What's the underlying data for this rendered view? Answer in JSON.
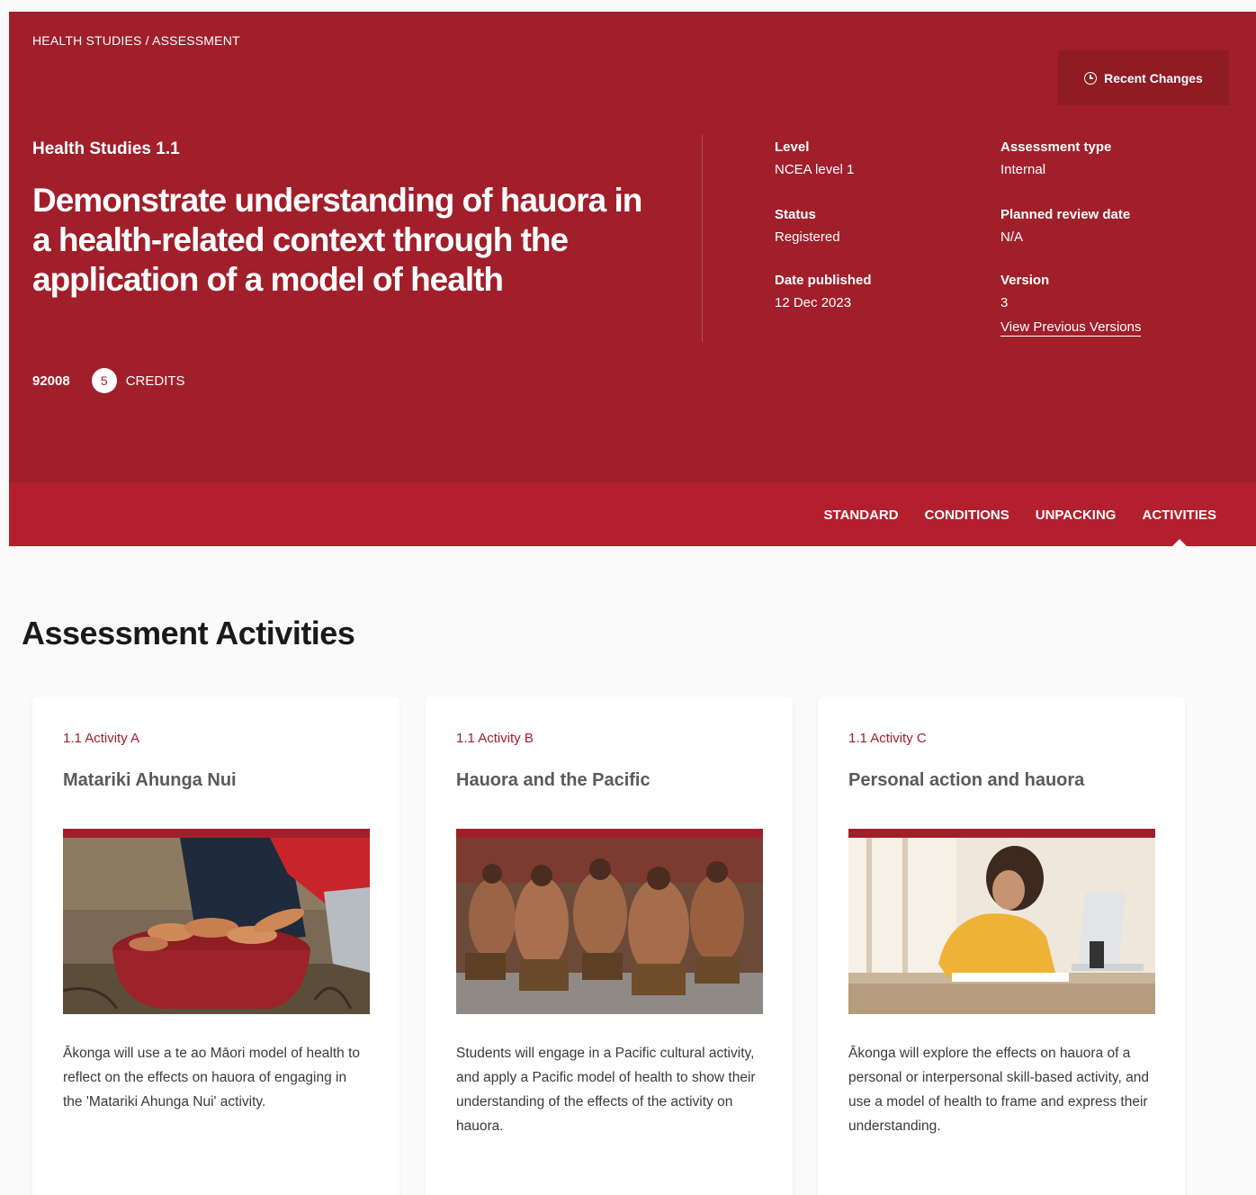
{
  "breadcrumb": {
    "subject": "HEALTH STUDIES",
    "separator": "/",
    "section": "ASSESSMENT"
  },
  "recent_changes_label": "Recent Changes",
  "standard": {
    "subject_label": "Health Studies 1.1",
    "title": "Demonstrate understanding of hauora in a health-related context through the application of a model of health",
    "code": "92008",
    "credits": "5",
    "credits_label": "CREDITS"
  },
  "meta": {
    "level": {
      "label": "Level",
      "value": "NCEA level 1"
    },
    "assessment_type": {
      "label": "Assessment type",
      "value": "Internal"
    },
    "status": {
      "label": "Status",
      "value": "Registered"
    },
    "review_date": {
      "label": "Planned review date",
      "value": "N/A"
    },
    "date_published": {
      "label": "Date published",
      "value": "12 Dec 2023"
    },
    "version": {
      "label": "Version",
      "value": "3",
      "link": "View Previous Versions"
    }
  },
  "tabs": [
    {
      "label": "STANDARD",
      "active": false
    },
    {
      "label": "CONDITIONS",
      "active": false
    },
    {
      "label": "UNPACKING",
      "active": false
    },
    {
      "label": "ACTIVITIES",
      "active": true
    }
  ],
  "section_title": "Assessment Activities",
  "activities": [
    {
      "tag": "1.1 Activity A",
      "title": "Matariki Ahunga Nui",
      "image": "harvest-kumara-photo",
      "description": "Ākonga will use a te ao Māori model of health to reflect on the effects on hauora of engaging in the 'Matariki Ahunga Nui' activity."
    },
    {
      "tag": "1.1 Activity B",
      "title": "Hauora and the Pacific",
      "image": "pacific-dance-photo",
      "description": "Students will engage in a Pacific cultural activity, and apply a Pacific model of health to show their understanding of the effects of the activity on hauora."
    },
    {
      "tag": "1.1 Activity C",
      "title": "Personal action and hauora",
      "image": "student-writing-photo",
      "description": "Ākonga will explore the effects on hauora of a personal or interpersonal skill-based activity, and use a model of health to frame and express their understanding."
    }
  ],
  "colors": {
    "primary": "#a01f2a",
    "tabbar": "#b31f2d",
    "background": "#fafafa"
  }
}
